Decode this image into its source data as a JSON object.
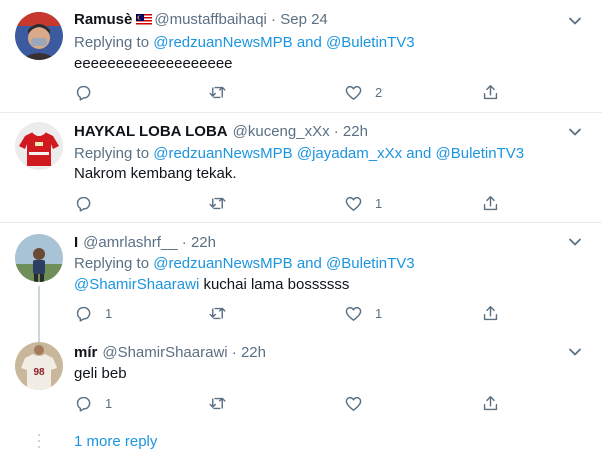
{
  "tweets": [
    {
      "name": "Ramusè",
      "handle": "@mustaffbaihaqi",
      "time": "Sep 24",
      "replying_prefix": "Replying to ",
      "mention1": "@redzuanNewsMPB",
      "joiner": " and ",
      "mention2": "@BuletinTV3",
      "text": "eeeeeeeeeeeeeeeeeee",
      "reply_count": "",
      "like_count": "2"
    },
    {
      "name": "HAYKAL LOBA LOBA",
      "handle": "@kuceng_xXx",
      "time": "22h",
      "replying_prefix": "Replying to ",
      "mention1": "@redzuanNewsMPB",
      "mention2": "@jayadam_xXx",
      "joiner": " and ",
      "mention3": "@BuletinTV3",
      "text": "Nakrom kembang tekak.",
      "reply_count": "",
      "like_count": "1"
    },
    {
      "name": "I",
      "handle": "@amrlashrf__",
      "time": "22h",
      "replying_prefix": "Replying to ",
      "mention1": "@redzuanNewsMPB",
      "joiner": " and ",
      "mention2": "@BuletinTV3",
      "mention_inline": "@ShamirShaarawi",
      "text": " kuchai lama bossssss",
      "reply_count": "1",
      "like_count": "1"
    },
    {
      "name": "mír",
      "handle": "@ShamirShaarawi",
      "time": "22h",
      "text": "geli beb",
      "reply_count": "1",
      "like_count": ""
    }
  ],
  "dot": " · ",
  "more_replies": "1 more reply",
  "icons": {
    "reply": "reply-icon",
    "retweet": "retweet-icon",
    "like": "heart-icon",
    "share": "share-icon",
    "caret": "chevron-down-icon",
    "flag": "malaysia-flag-icon"
  },
  "colors": {
    "link": "#1b95e0",
    "secondary": "#5b7083",
    "divider": "#e6ecf0"
  }
}
